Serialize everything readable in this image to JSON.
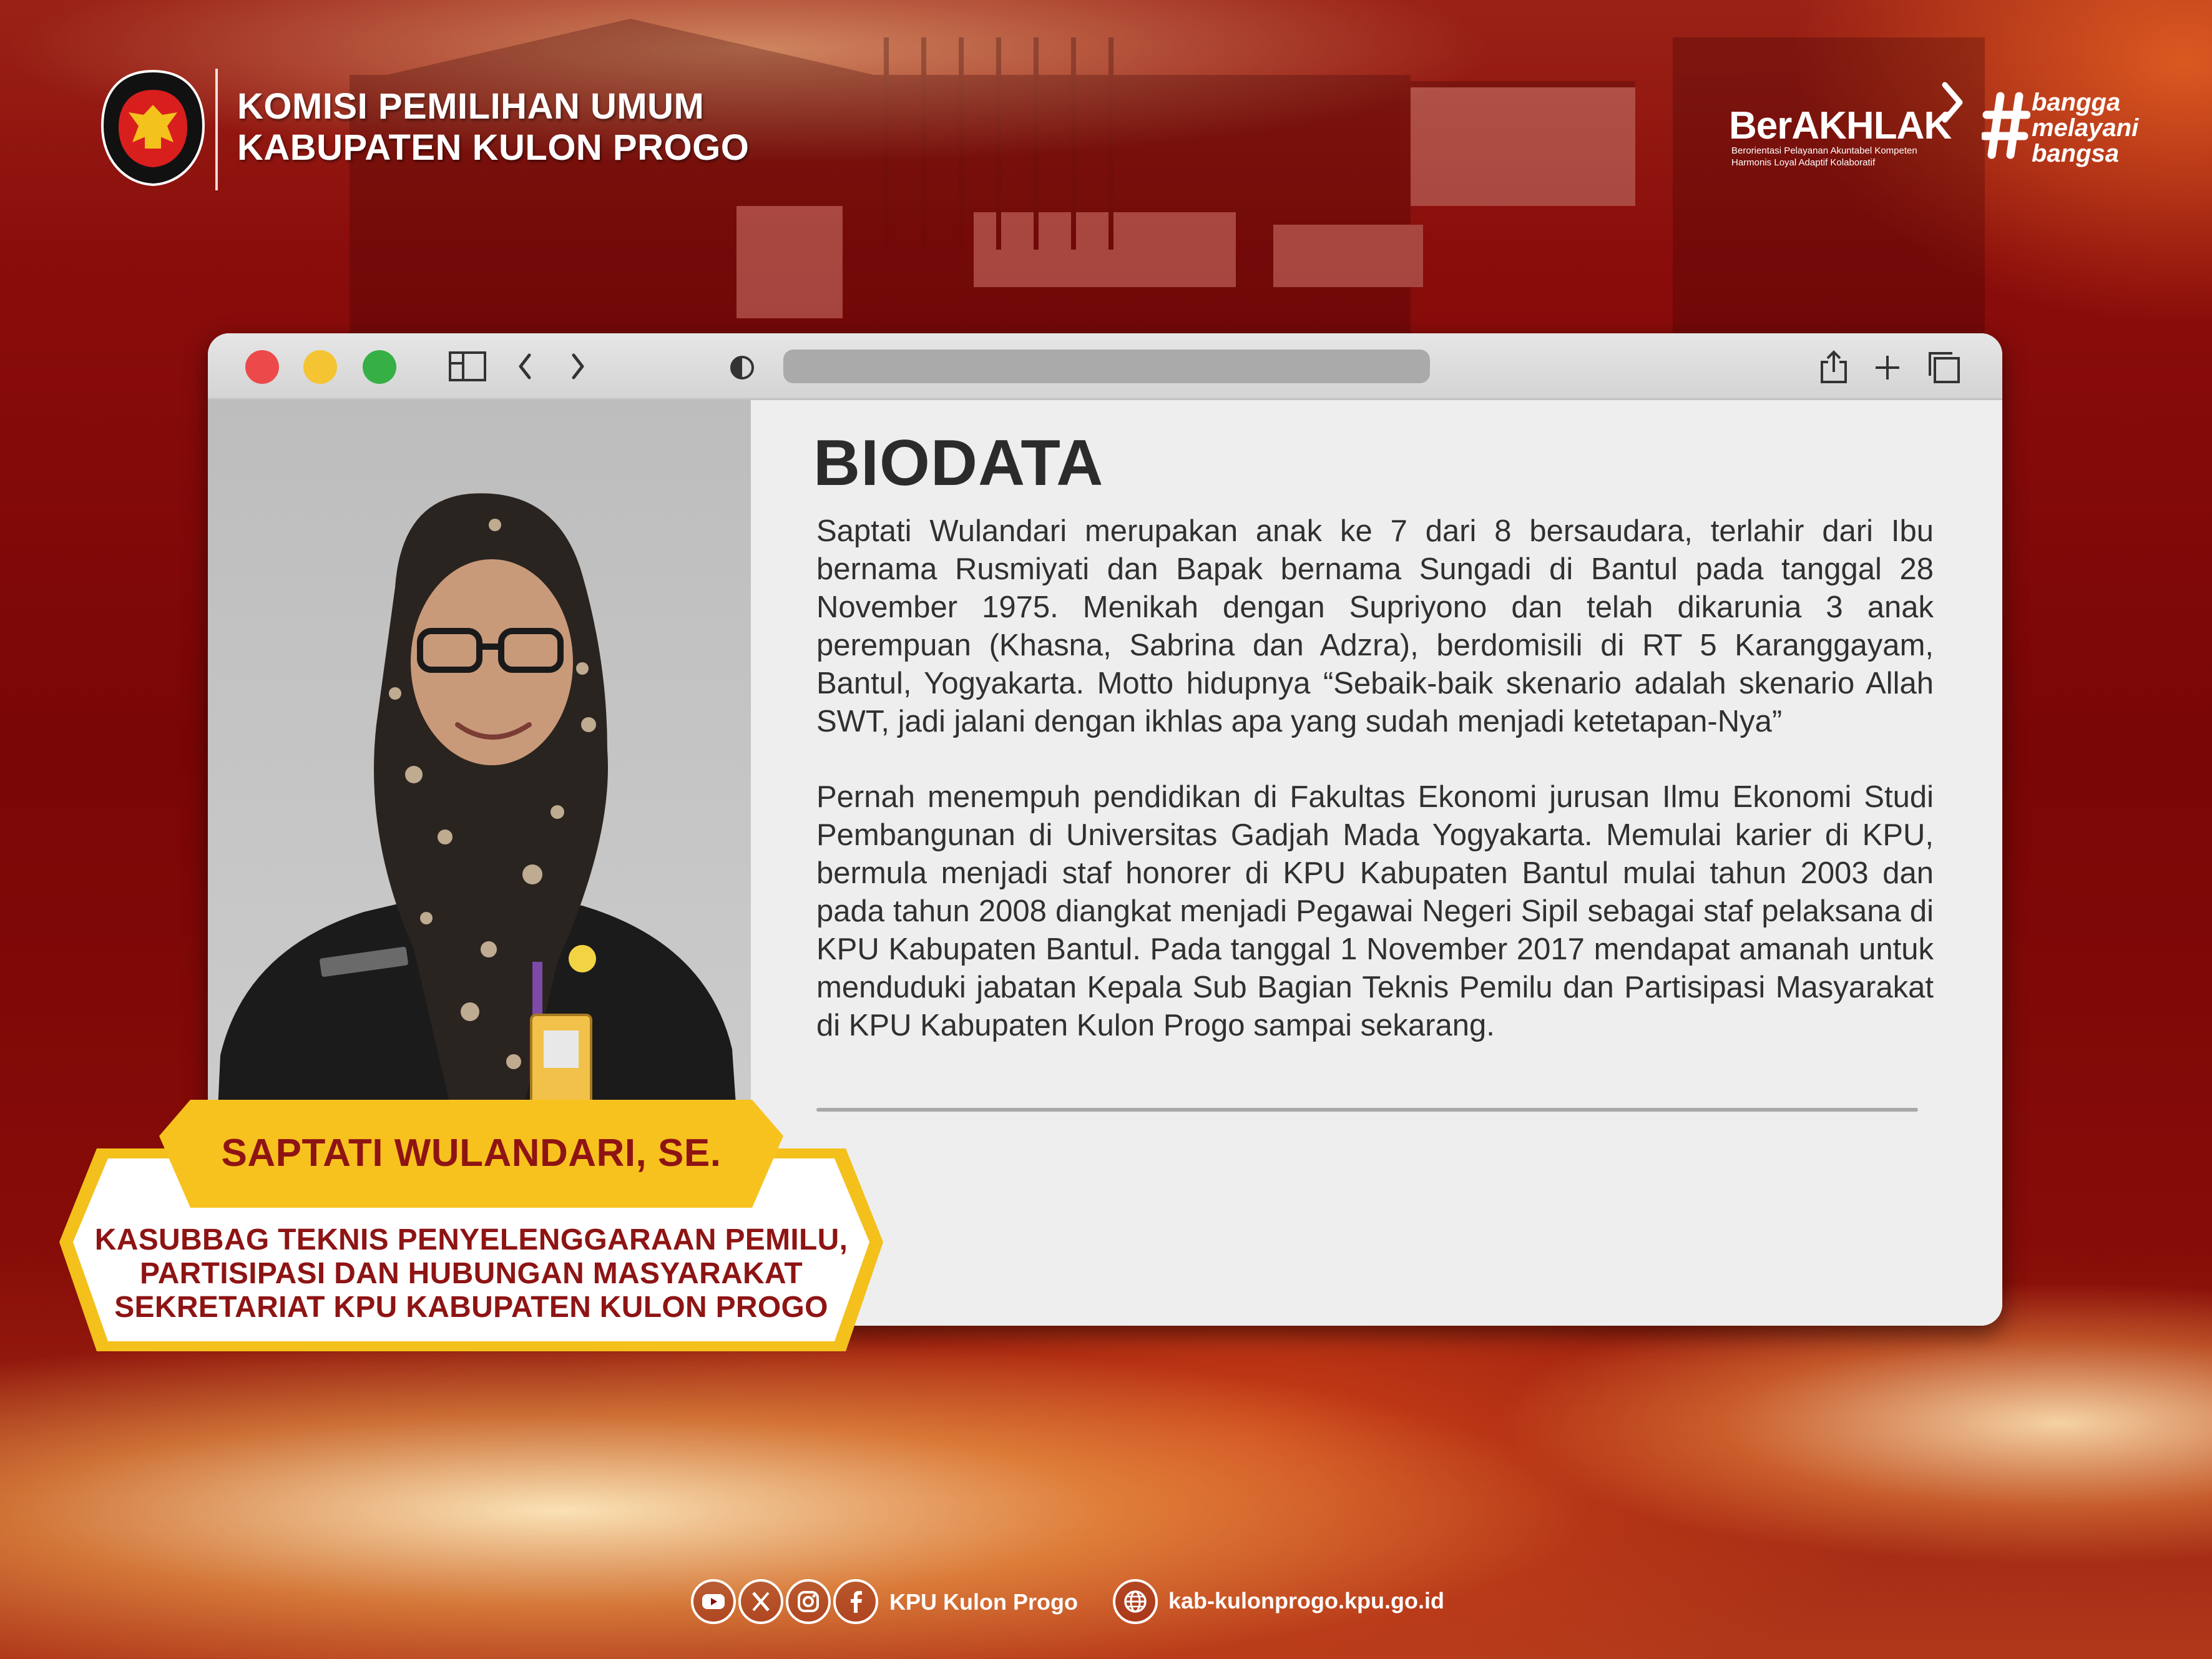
{
  "header": {
    "org_line1": "KOMISI PEMILIHAN UMUM",
    "org_line2": "KABUPATEN KULON PROGO",
    "logo_top": "KOMISI",
    "logo_bottom": "PEMILIHAN UMUM"
  },
  "branding": {
    "berakhlak": "BerAKHLAK",
    "berakhlak_tagline_1": "Berorientasi Pelayanan Akuntabel Kompeten",
    "berakhlak_tagline_2": "Harmonis Loyal Adaptif Kolaboratif",
    "bangga_1": "bangga",
    "bangga_2": "melayani",
    "bangga_3": "bangsa"
  },
  "browser": {
    "icons": [
      "sidebar-icon",
      "back-icon",
      "forward-icon",
      "contrast-icon",
      "share-icon",
      "plus-icon",
      "tabs-icon"
    ]
  },
  "biodata": {
    "title": "BIODATA",
    "paragraph_1": "Saptati Wulandari merupakan anak ke 7 dari 8 bersaudara, terlahir dari Ibu bernama Rusmiyati dan Bapak bernama Sungadi di Bantul pada tanggal 28 November 1975. Menikah dengan Supriyono dan telah dikarunia 3 anak perempuan (Khasna, Sabrina dan Adzra), berdomisili di RT 5 Karanggayam, Bantul, Yogyakarta. Motto hidupnya “Sebaik-baik skenario adalah skenario Allah SWT, jadi jalani dengan ikhlas apa yang sudah menjadi ketetapan-Nya”",
    "paragraph_2": "Pernah menempuh pendidikan di Fakultas Ekonomi jurusan Ilmu Ekonomi Studi Pembangunan di Universitas Gadjah Mada Yogyakarta. Memulai karier di KPU, bermula menjadi staf honorer di KPU Kabupaten Bantul mulai tahun 2003 dan pada tahun 2008 diangkat menjadi Pegawai Negeri Sipil sebagai staf pelaksana di KPU Kabupaten Bantul. Pada tanggal 1 November 2017 mendapat amanah untuk menduduki jabatan Kepala Sub Bagian Teknis Pemilu dan Partisipasi Masyarakat di KPU Kabupaten Kulon Progo sampai sekarang."
  },
  "person": {
    "name": "SAPTATI WULANDARI, SE.",
    "position_line1": "KASUBBAG TEKNIS PENYELENGGARAAN PEMILU,",
    "position_line2": "PARTISIPASI DAN HUBUNGAN MASYARAKAT",
    "position_line3": "SEKRETARIAT KPU KABUPATEN KULON PROGO"
  },
  "footer": {
    "social_icons": [
      "youtube-icon",
      "x-icon",
      "instagram-icon",
      "facebook-icon"
    ],
    "handle": "KPU Kulon Progo",
    "website": "kab-kulonprogo.kpu.go.id"
  },
  "colors": {
    "background": "#7a0707",
    "accent_gold": "#f7c21e",
    "name_red": "#8e1414",
    "window_bg": "#efefef"
  }
}
